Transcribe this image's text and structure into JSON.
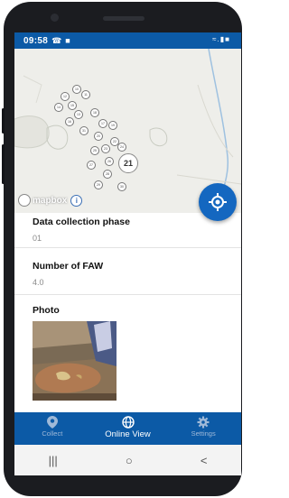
{
  "status_bar": {
    "time": "09:58",
    "whatsapp_icon": "whatsapp-icon",
    "notification_icon": "notification-icon",
    "signal_icons": "wifi-signal-battery-icons"
  },
  "map": {
    "cluster_count": "21",
    "attribution": "mapbox",
    "info_icon": "i",
    "marker_labels": [
      "10",
      "12",
      "11",
      "15",
      "14",
      "13",
      "16",
      "18",
      "17",
      "19",
      "20",
      "22",
      "23",
      "24",
      "25",
      "26",
      "27",
      "28",
      "29",
      "30",
      "31"
    ]
  },
  "fields": [
    {
      "label": "Data collection phase",
      "value": "01"
    },
    {
      "label": "Number of FAW",
      "value": "4.0"
    },
    {
      "label": "Photo",
      "value": ""
    }
  ],
  "bottom_nav": {
    "items": [
      {
        "label": "Collect",
        "icon": "location-pin-icon",
        "active": false
      },
      {
        "label": "Online View",
        "icon": "globe-icon",
        "active": true
      },
      {
        "label": "Settings",
        "icon": "gear-icon",
        "active": false
      }
    ]
  },
  "system_nav": {
    "recents": "|||",
    "home": "○",
    "back": "<"
  },
  "colors": {
    "primary": "#0c5aa6",
    "fab": "#1467c0",
    "map_bg": "#eeeeea"
  }
}
